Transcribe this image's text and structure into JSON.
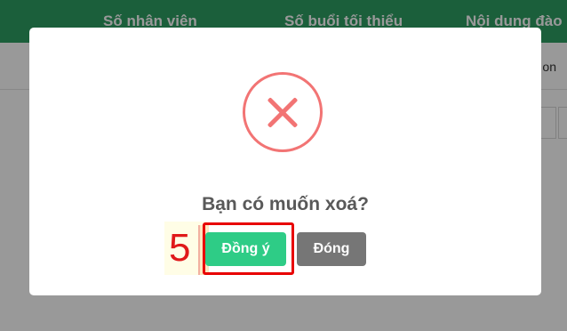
{
  "background": {
    "table_headers": [
      "Số nhân viên",
      "Số buổi tối thiểu",
      "Nội dung đào"
    ],
    "toolbar_text": "on",
    "header_color": "#2e9e63"
  },
  "dialog": {
    "icon": "error-x-icon",
    "icon_color": "#f27474",
    "question": "Bạn có muốn xoá?",
    "confirm_label": "Đồng ý",
    "confirm_color": "#2ecc86",
    "close_label": "Đóng",
    "close_color": "#767676"
  },
  "annotation": {
    "step_number": "5",
    "color": "#e80000"
  }
}
